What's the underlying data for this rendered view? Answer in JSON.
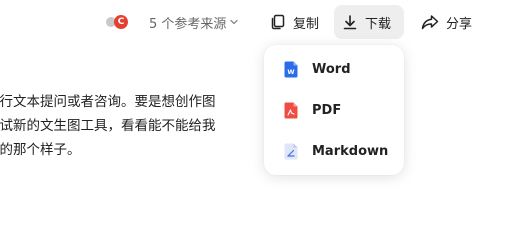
{
  "toolbar": {
    "references_label": "5 个参考来源",
    "copy_label": "复制",
    "download_label": "下载",
    "share_label": "分享"
  },
  "content": {
    "lines": [
      "进行文本提问或者咨询。要是想创作图",
      "试试新的文生图工具，看看能不能给我",
      "要的那个样子。"
    ]
  },
  "download_menu": {
    "items": [
      {
        "label": "Word",
        "icon": "word-file-icon",
        "color": "#2b6ce8"
      },
      {
        "label": "PDF",
        "icon": "pdf-file-icon",
        "color": "#ef4d43"
      },
      {
        "label": "Markdown",
        "icon": "markdown-file-icon",
        "color": "#c9d6f5"
      }
    ]
  }
}
